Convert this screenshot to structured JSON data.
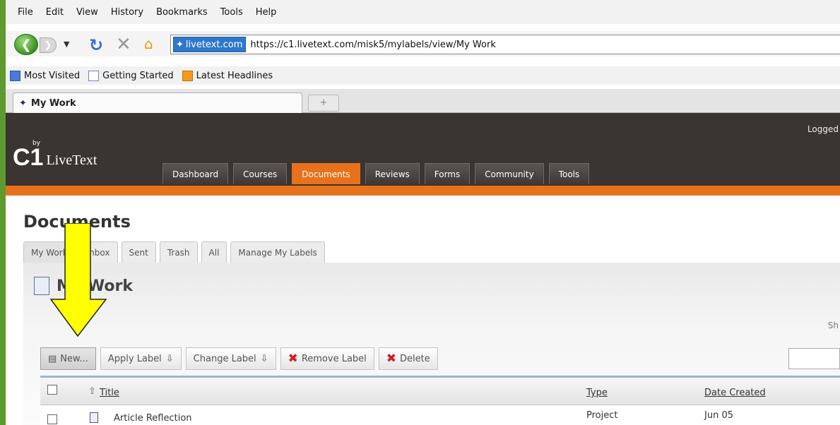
{
  "browser": {
    "menu": [
      "File",
      "Edit",
      "View",
      "History",
      "Bookmarks",
      "Tools",
      "Help"
    ],
    "site_badge": "livetext.com",
    "url": "https://c1.livetext.com/misk5/mylabels/view/My Work",
    "bookmarks": [
      "Most Visited",
      "Getting Started",
      "Latest Headlines"
    ],
    "tab_title": "My Work"
  },
  "app": {
    "logged_in_text": "Logged",
    "brand_c1": "C1",
    "brand_by": "by",
    "brand_name": "LiveText",
    "nav": [
      "Dashboard",
      "Courses",
      "Documents",
      "Reviews",
      "Forms",
      "Community",
      "Tools"
    ],
    "nav_active": "Documents"
  },
  "page": {
    "title": "Documents",
    "subtabs": [
      "My Work",
      "Inbox",
      "Sent",
      "Trash",
      "All",
      "Manage My Labels"
    ],
    "panel_title": "My Work",
    "show_text": "Sh"
  },
  "toolbar": {
    "new": "New...",
    "apply_label": "Apply Label",
    "change_label": "Change Label",
    "remove_label": "Remove Label",
    "delete": "Delete"
  },
  "table": {
    "headers": {
      "title": "Title",
      "type": "Type",
      "date_created": "Date Created"
    },
    "rows": [
      {
        "title": "Article Reflection",
        "type": "Project",
        "date_created": "Jun 05"
      }
    ]
  },
  "colors": {
    "accent_orange": "#e8721c",
    "header_dark": "#3a3432",
    "annotation_arrow": "#ffff00"
  }
}
